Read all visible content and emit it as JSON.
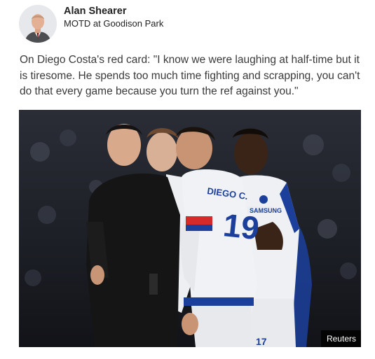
{
  "author": {
    "name": "Alan Shearer",
    "subtitle": "MOTD at Goodison Park"
  },
  "post": {
    "text": "On Diego Costa's red card: \"I know we were laughing at half-time but it is tiresome. He spends too much time fighting and scrapping, you can't do that every game because you turn the ref against you.\""
  },
  "photo": {
    "credit": "Reuters",
    "shirt_lettering": {
      "costa_name": "DIEGO C.",
      "costa_number": "19",
      "sponsor": "SAMSUNG",
      "costa_number_back": "17"
    }
  },
  "colors": {
    "chelsea_blue": "#1c3f9c",
    "kit_red": "#d42a2a",
    "referee_black": "#151515",
    "credit_bg": "#000000"
  }
}
